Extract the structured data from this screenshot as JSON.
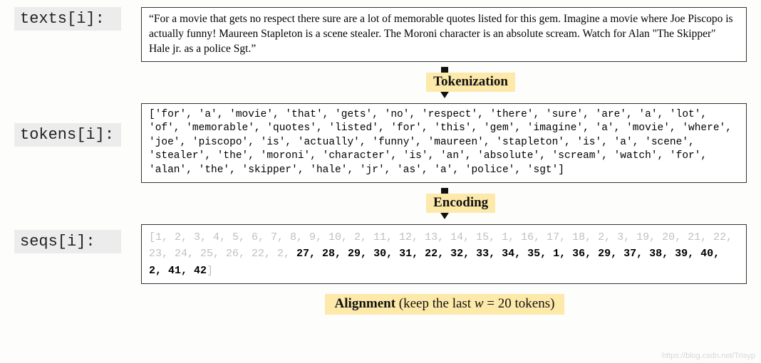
{
  "row1": {
    "label": "texts[i]:",
    "text": "“For a movie that gets no respect there sure are a lot of memorable quotes listed for this gem. Imagine a movie where Joe Piscopo is actually funny! Maureen Stapleton is a scene stealer. The Moroni character is an absolute scream. Watch for Alan \"The Skipper\" Hale jr. as a police Sgt.”"
  },
  "step1": {
    "label": "Tokenization"
  },
  "row2": {
    "label": "tokens[i]:",
    "text": "['for', 'a', 'movie', 'that', 'gets', 'no', 'respect', 'there', 'sure', 'are', 'a', 'lot', 'of', 'memorable', 'quotes', 'listed', 'for', 'this', 'gem', 'imagine', 'a', 'movie', 'where', 'joe', 'piscopo', 'is', 'actually', 'funny', 'maureen', 'stapleton', 'is', 'a', 'scene', 'stealer', 'the', 'moroni', 'character', 'is', 'an', 'absolute', 'scream', 'watch', 'for', 'alan', 'the', 'skipper', 'hale', 'jr', 'as', 'a', 'police', 'sgt']"
  },
  "step2": {
    "label": "Encoding"
  },
  "row3": {
    "label": "seqs[i]:",
    "seq_faded_prefix": "[1, 2, 3, 4, 5, 6, 7, 8, 9, 10, 2, 11, 12, 13, 14, 15, 1, 16, 17, 18, 2, 3, 19, 20, 21, 22, 23, 24, 25, 26, 22, 2, ",
    "seq_bold": "27, 28, 29, 30, 31, 22, 32, 33, 34, 35, 1, 36, 29, 37, 38, 39, 40, 2, 41, 42",
    "seq_suffix": "]"
  },
  "alignment": {
    "bold": "Alignment",
    "rest_prefix": " (keep the last ",
    "italic": "w",
    "rest_suffix": " = 20 tokens)"
  },
  "watermark": "https://blog.csdn.net/Trisyp"
}
